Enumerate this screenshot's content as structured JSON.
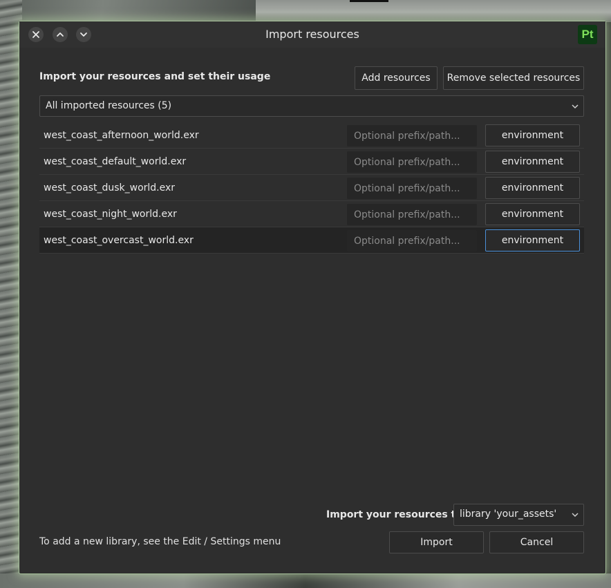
{
  "window": {
    "title": "Import resources",
    "app_logo": "Pt"
  },
  "header": {
    "heading": "Import your resources and set their usage",
    "add_label": "Add resources",
    "remove_label": "Remove selected resources"
  },
  "filter": {
    "selected": "All imported resources (5)"
  },
  "resources": [
    {
      "file": "west_coast_afternoon_world.exr",
      "prefix_placeholder": "Optional prefix/path...",
      "usage": "environment"
    },
    {
      "file": "west_coast_default_world.exr",
      "prefix_placeholder": "Optional prefix/path...",
      "usage": "environment"
    },
    {
      "file": "west_coast_dusk_world.exr",
      "prefix_placeholder": "Optional prefix/path...",
      "usage": "environment"
    },
    {
      "file": "west_coast_night_world.exr",
      "prefix_placeholder": "Optional prefix/path...",
      "usage": "environment"
    },
    {
      "file": "west_coast_overcast_world.exr",
      "prefix_placeholder": "Optional prefix/path...",
      "usage": "environment"
    }
  ],
  "footer": {
    "import_to_label": "Import your resources to:",
    "library_selected": "library 'your_assets'",
    "hint": "To add a new library, see the Edit / Settings menu",
    "import_label": "Import",
    "cancel_label": "Cancel"
  },
  "icons": {
    "close": "close-icon",
    "up": "chevron-up-icon",
    "down": "chevron-down-icon"
  },
  "colors": {
    "accent_focus": "#4a90d9",
    "dialog_bg": "#2e2e2e",
    "logo_bg": "#0d3a14",
    "logo_fg": "#7fe05a",
    "glow": "#a6c09a"
  }
}
